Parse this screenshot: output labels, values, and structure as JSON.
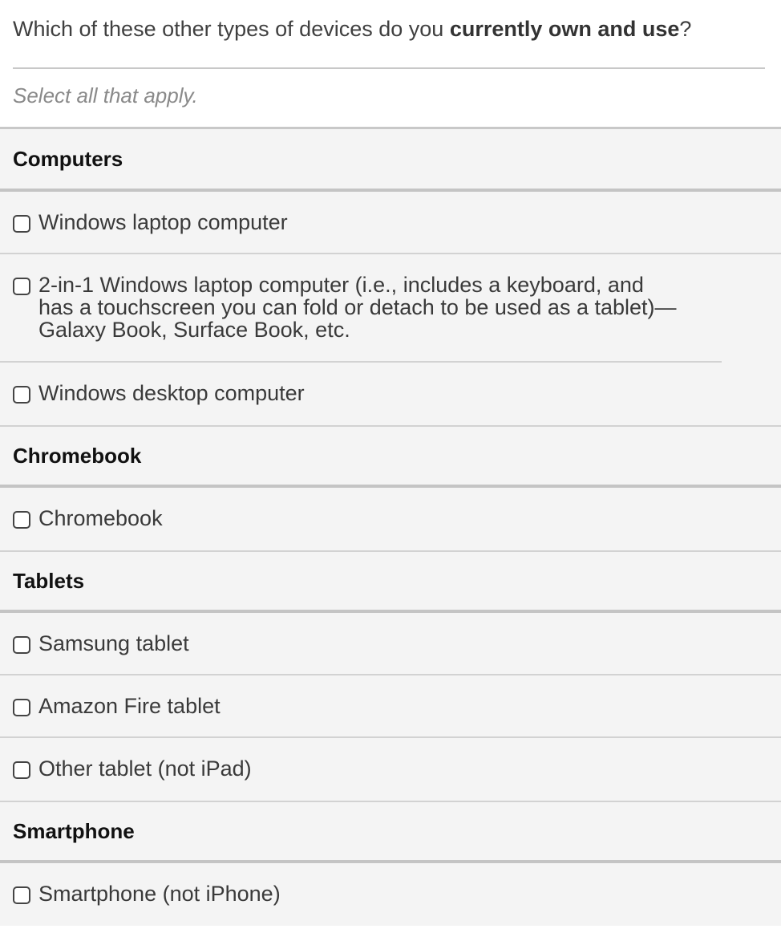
{
  "question": {
    "prefix": "Which of these other types of devices do you ",
    "bold": "currently own and use",
    "suffix": "?"
  },
  "hint": "Select all that apply.",
  "groups": [
    {
      "label": "Computers",
      "items": [
        {
          "label": "Windows laptop computer",
          "checked": false
        },
        {
          "label": "2-in-1 Windows laptop computer (i.e., includes a keyboard, and has a touchscreen you can fold or detach to be used as a tablet)—Galaxy Book, Surface Book, etc.",
          "checked": false
        },
        {
          "label": "Windows desktop computer",
          "checked": false
        }
      ]
    },
    {
      "label": "Chromebook",
      "items": [
        {
          "label": "Chromebook",
          "checked": false
        }
      ]
    },
    {
      "label": "Tablets",
      "items": [
        {
          "label": "Samsung tablet",
          "checked": false
        },
        {
          "label": "Amazon Fire tablet",
          "checked": false
        },
        {
          "label": "Other tablet (not iPad)",
          "checked": false
        }
      ]
    },
    {
      "label": "Smartphone",
      "items": [
        {
          "label": "Smartphone (not iPhone)",
          "checked": false
        }
      ]
    }
  ]
}
